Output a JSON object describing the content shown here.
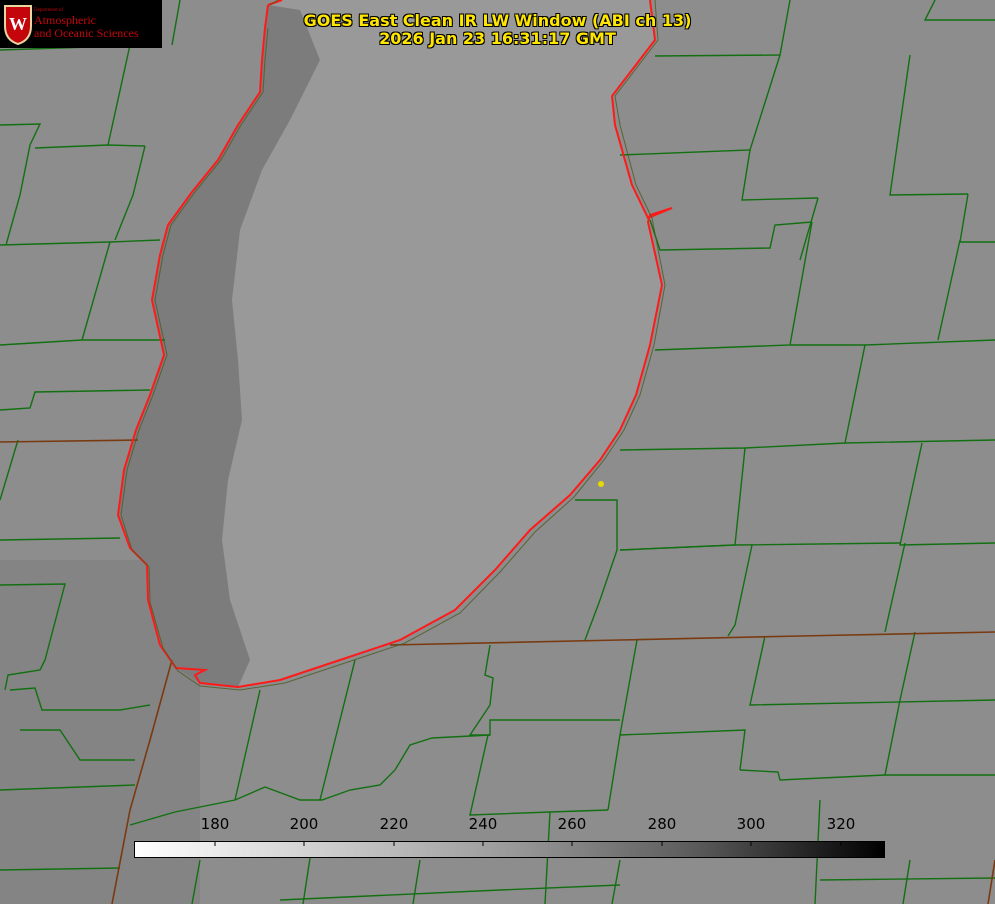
{
  "title": {
    "line1": "GOES East Clean IR LW Window (ABI ch 13)",
    "line2": "2026 Jan 23 16:31:17 GMT"
  },
  "logo": {
    "department": "Department of",
    "line1": "Atmospheric",
    "line2": "and Oceanic Sciences",
    "emblem_letter": "W"
  },
  "colorbar": {
    "ticks": [
      "180",
      "200",
      "220",
      "240",
      "260",
      "280",
      "300",
      "320"
    ],
    "colormap": "grayscale, white (cold) to black (warm)"
  },
  "colors": {
    "county_lines": "#127012",
    "lake_outline": "#ff1a1a",
    "title_text": "#ffe600",
    "land_gray": "#8e8e8e",
    "lake_gray": "#9a9a9a",
    "marker": "#e6d800"
  }
}
